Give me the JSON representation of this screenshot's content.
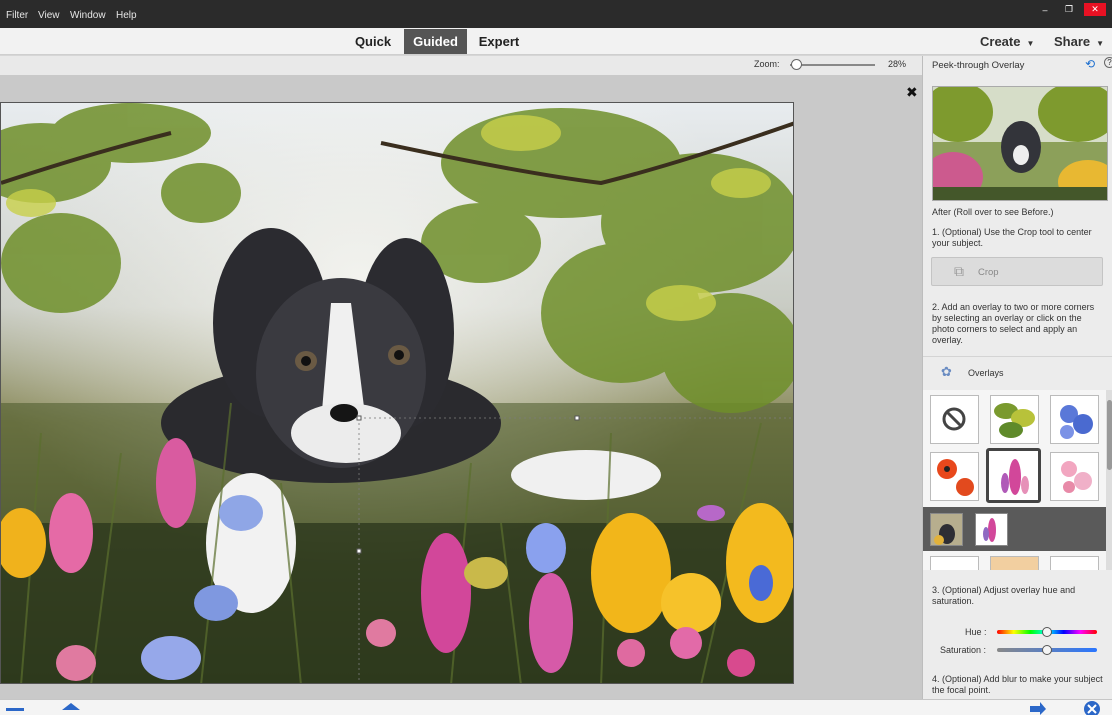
{
  "menubar": {
    "items": [
      "Filter",
      "View",
      "Window",
      "Help"
    ],
    "window_controls": [
      "minimize-icon",
      "restore-icon",
      "close-icon"
    ]
  },
  "modes": {
    "tabs": [
      "Quick",
      "Guided",
      "Expert"
    ],
    "active": "Guided",
    "create": "Create",
    "share": "Share"
  },
  "zoom": {
    "label": "Zoom:",
    "value": "28%",
    "level": 0.28
  },
  "panel": {
    "title": "Peek-through Overlay",
    "after_text": "After (Roll over to see Before.)",
    "step1": "1. (Optional) Use the Crop tool to center your subject.",
    "crop_label": "Crop",
    "step2": "2. Add an overlay to two or more corners by selecting an overlay or click on the photo corners to select and apply an overlay.",
    "overlays_label": "Overlays",
    "overlay_thumbs": [
      "no-overlay",
      "leaves",
      "blue-flowers",
      "red-poppies",
      "pink-wildflowers",
      "pink-blossoms"
    ],
    "step3": "3. (Optional) Adjust overlay hue and saturation.",
    "hue_label": "Hue :",
    "saturation_label": "Saturation :",
    "hue_level": 0.5,
    "saturation_level": 0.5,
    "step4": "4. (Optional) Add blur to make your subject the focal point."
  },
  "colors": {
    "menubar": "#2b2b2b",
    "active_tab": "#555555",
    "accent": "#1d6fcf"
  }
}
